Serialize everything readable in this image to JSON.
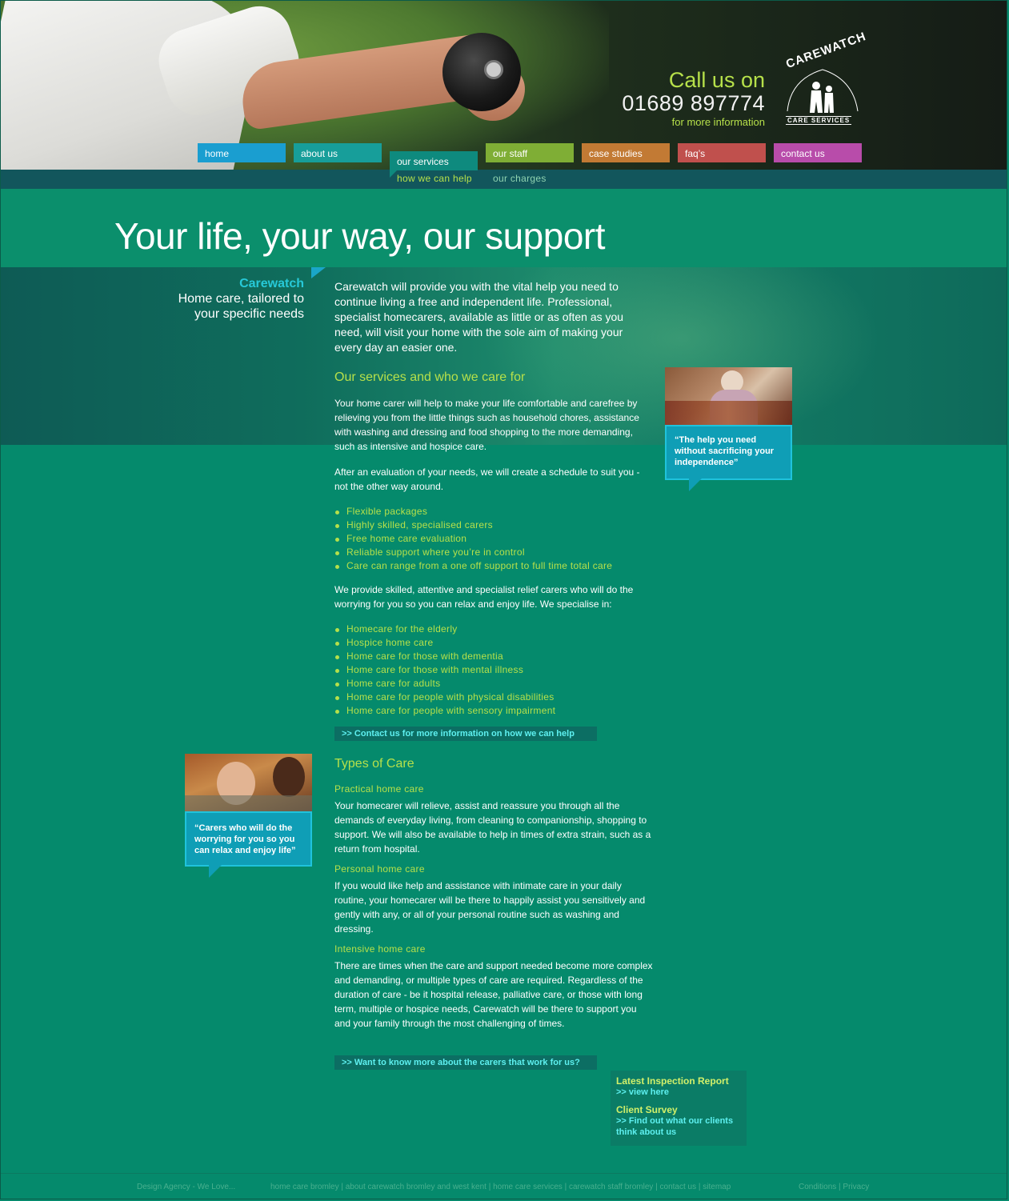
{
  "header": {
    "call_line1": "Call us on",
    "phone": "01689 897774",
    "call_line3": "for more information",
    "logo_text": "CAREWATCH",
    "logo_sub": "CARE SERVICES"
  },
  "nav": [
    {
      "label": "home",
      "color": "#1a9ed0"
    },
    {
      "label": "about us",
      "color": "#179e9a"
    },
    {
      "label": "our services",
      "color": "#0e8a7e"
    },
    {
      "label": "our staff",
      "color": "#7fae35"
    },
    {
      "label": "case studies",
      "color": "#c27a34"
    },
    {
      "label": "faq’s",
      "color": "#c0504d"
    },
    {
      "label": "contact us",
      "color": "#b84caa"
    }
  ],
  "subnav": [
    {
      "label": "how we can help",
      "color": "#b6e04a"
    },
    {
      "label": "our charges",
      "color": "#8fd3b0"
    }
  ],
  "page_title": "Your life, your way, our support",
  "tagline": {
    "brand": "Carewatch",
    "line1": "Home care, tailored to",
    "line2": "your specific needs"
  },
  "intro": "Carewatch will provide you with the vital help you need to continue living a free and independent life. Professional, specialist homecarers, available as little or as often as you need, will visit your home with the sole aim of making your every day an easier one.",
  "services": {
    "heading": "Our services and who we care for",
    "p1": "Your home carer will help to make your life comfortable and carefree by relieving you from the little things such as household chores, assistance with washing and dressing and food shopping to the more demanding, such as intensive and hospice care.",
    "p2": "After an evaluation of your needs, we will create a schedule to suit you - not the other way around.",
    "list1": [
      "Flexible packages",
      "Highly skilled, specialised carers",
      "Free home care evaluation",
      "Reliable support where you’re in control",
      "Care can range from a one off support to full time total care"
    ],
    "p3": "We provide skilled, attentive and specialist relief carers who will do the worrying for you so you can relax and enjoy life. We specialise in:",
    "list2": [
      "Homecare for the elderly",
      "Hospice home care",
      "Home care for those with dementia",
      "Home care for those with mental illness",
      "Home care for adults",
      "Home care for people with physical disabilities",
      "Home care for people with sensory impairment"
    ],
    "cta": ">> Contact us for more information on how we can help"
  },
  "quote1": "“The help you need without sacrificing your independence”",
  "quote2": "“Carers who will do the worrying for you so you can relax and enjoy life”",
  "types": {
    "heading": "Types of Care",
    "items": [
      {
        "title": "Practical home care",
        "text": "Your homecarer will relieve, assist and reassure you through all the demands of everyday living, from cleaning to companionship, shopping to support. We will also be available to help in times of extra strain, such as a return from hospital."
      },
      {
        "title": "Personal home care",
        "text": "If you would like help and assistance with intimate care in your daily routine, your homecarer will be there to happily assist you sensitively and gently with any, or all of your personal routine such as washing and dressing."
      },
      {
        "title": "Intensive home care",
        "text": "There are times when the care and support needed become more complex and demanding, or multiple types of care are required. Regardless of the duration of care - be it hospital release, palliative care, or those with long term, multiple or hospice needs, Carewatch will be there to support you and your family through the most challenging of times."
      }
    ],
    "cta": ">> Want to know more about the carers that work for us?"
  },
  "sidebox": {
    "h1": "Latest Inspection Report",
    "l1": ">> view here",
    "h2": "Client Survey",
    "l2a": ">> Find out what our clients",
    "l2b": "think about us"
  },
  "footer": {
    "agency": "Design Agency - We Love...",
    "links": "home care bromley | about carewatch bromley and west kent | home care services | carewatch staff bromley | contact us | sitemap",
    "legal": "Conditions | Privacy"
  }
}
